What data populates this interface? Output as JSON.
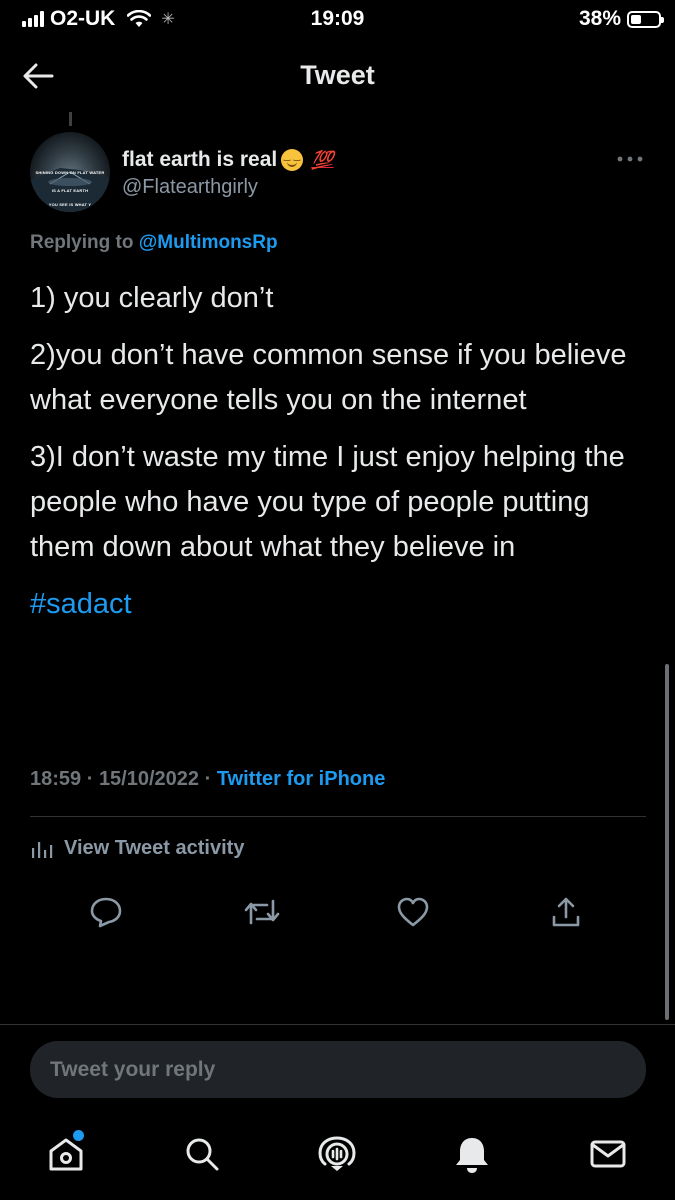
{
  "status_bar": {
    "carrier": "O2-UK",
    "time": "19:09",
    "battery": "38%",
    "battery_level": 0.38
  },
  "header": {
    "title": "Tweet",
    "back_icon": "arrow-left-icon"
  },
  "tweet": {
    "avatar_lines": [
      "SHINING DOWN ON FLAT WATER",
      "IS A FLAT EARTH",
      "YOU SEE IS WHAT Y"
    ],
    "display_name": "flat earth is real",
    "handle": "@Flatearthgirly",
    "replying_prefix": "Replying to",
    "replying_to": "@MultimonsRp",
    "paragraphs": [
      "1) you clearly don’t",
      "2)you don’t have common sense if you believe what everyone tells you on the internet",
      "3)I don’t waste my time I just enjoy helping the people who have you type of people putting them down about what they believe in"
    ],
    "hashtag": "#sadact",
    "time": "18:59",
    "date": "15/10/2022",
    "source": "Twitter for iPhone",
    "activity_label": "View Tweet activity"
  },
  "reply": {
    "placeholder": "Tweet your reply"
  },
  "colors": {
    "accent": "#1d9bf0",
    "background": "#000000",
    "muted": "#71767b",
    "text": "#e7e9ea"
  }
}
